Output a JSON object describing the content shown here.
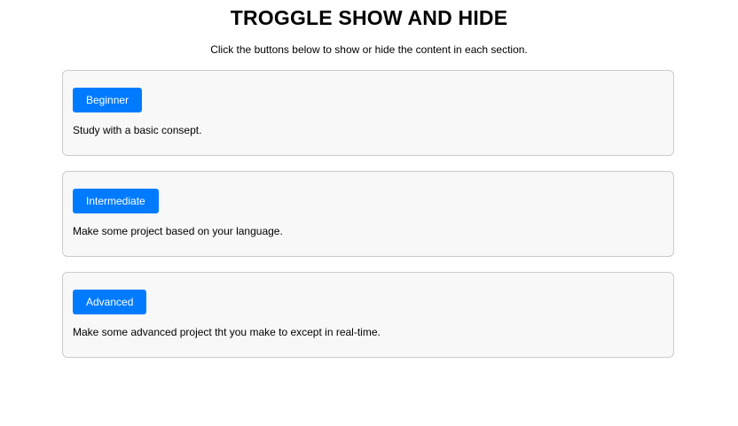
{
  "header": {
    "title": "TROGGLE SHOW AND HIDE",
    "subtitle": "Click the buttons below to show or hide the content in each section."
  },
  "sections": [
    {
      "button_label": "Beginner",
      "content": "Study with a basic consept."
    },
    {
      "button_label": "Intermediate",
      "content": "Make some project based on your language."
    },
    {
      "button_label": "Advanced",
      "content": "Make some advanced project tht you make to except in real-time."
    }
  ],
  "colors": {
    "button_bg": "#007bff",
    "button_text": "#ffffff",
    "section_bg": "#f8f8f8",
    "section_border": "#cccccc"
  }
}
